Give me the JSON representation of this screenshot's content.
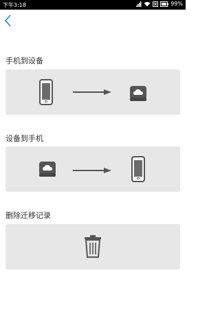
{
  "status": {
    "time": "下午3:18",
    "battery_pct": "99%"
  },
  "sections": [
    {
      "title": "手机到设备"
    },
    {
      "title": "设备到手机"
    },
    {
      "title": "删除迁移记录"
    }
  ],
  "colors": {
    "card_bg": "#e7e7e7",
    "icon_dark": "#555555",
    "back_accent": "#1e88e5"
  },
  "icons": [
    "back-chevron",
    "phone",
    "cloud-drive",
    "arrow-right",
    "trash"
  ]
}
